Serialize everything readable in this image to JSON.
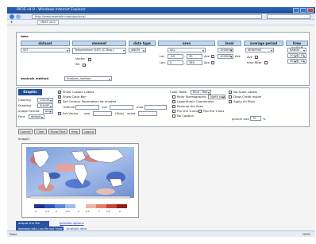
{
  "browser": {
    "title": "IRCIS v4.0 - Windows Internet Explorer",
    "url": "http://www.example.noaa.gov/ircis/",
    "favorites_tab": "IRCIS v4.0",
    "status": "Done",
    "zoom": "100%"
  },
  "dataset_panel": {
    "heading": "data",
    "columns": [
      "dataset",
      "element",
      "data type",
      "area",
      "level",
      "average period",
      "time period"
    ],
    "dataset": {
      "value": "SST"
    },
    "element": {
      "value": "Temperature (SST) [C Deg.]",
      "vector_label": "Vector",
      "sd_label": "SD"
    },
    "data_type": {
      "value": "ANOM"
    },
    "area": {
      "region": "ALL",
      "lat_label": "Lat",
      "lat_from": "-90",
      "lat_to": "90",
      "lon_label": "Lon",
      "lon_from": "0",
      "lon_to": "360",
      "ave_label": "Ave"
    },
    "level": {
      "value1": "1000hPa",
      "value2": "1000hPa",
      "ave_label": "Ave"
    },
    "average_period": {
      "value": "MONTHLY",
      "ave_label": "Ave",
      "time_filter_label": "time filter"
    },
    "time_period": {
      "range": "RANGE",
      "year1": "2012",
      "month1": "01",
      "year2": "2012",
      "month2": "01"
    },
    "analysis_method_label": "analysis method",
    "analysis_method_value": "Analysis_method"
  },
  "graphic_options": {
    "heading": "Graphic Option",
    "coloring_label": "Coloring",
    "coloring_value": "COLOR",
    "drawing_label": "Drawing",
    "drawing_value": "SHADE",
    "image_format_label": "Image Format",
    "image_format_value": "png",
    "font_label": "Font",
    "font_value": "default",
    "show_custom_labels": "Show Custom Labels",
    "show_color_bar": "Show Color Bar",
    "set_contour_params": "Set Contour Parameters for shaded",
    "interval_label": "interval",
    "min_label": "min",
    "max_label": "max",
    "set_vector": "Set Vector",
    "size_label": "size",
    "skip_label": "(Skip)",
    "value_label": "value",
    "color_table_label": "Color Table",
    "color_table_value": "Blue - Red",
    "polar_stereographic": "Polar Stereographic",
    "polar_value": "North pole",
    "logarithmic": "Logarithmic Coordinates",
    "reverse_axes": "Reverse the Axes",
    "flip_x": "Flip the X-axis",
    "flip_y": "Flip the Y-axis",
    "no_caption": "No Caption",
    "no_scale_labels": "No Scale Labels",
    "draw_credit": "Draw Credit Inside",
    "apply_all": "Apply All Plots",
    "picture_size_label": "picture size",
    "picture_size_value": "75",
    "picture_size_unit": "%"
  },
  "buttons": [
    "Submit",
    "Clear",
    "Show/Text",
    "Help",
    "Logout"
  ],
  "image_label": "image1",
  "colorbar_ticks": [
    "-2",
    "-1.5",
    "-1",
    "-0.5",
    "0",
    "0.5",
    "1",
    "1.5",
    "2"
  ],
  "bottom_links": {
    "output": "output the file",
    "download": "download data (.csv file and 'show' data .)",
    "detailed": "detailed options",
    "analysis_data": "analysis data"
  }
}
